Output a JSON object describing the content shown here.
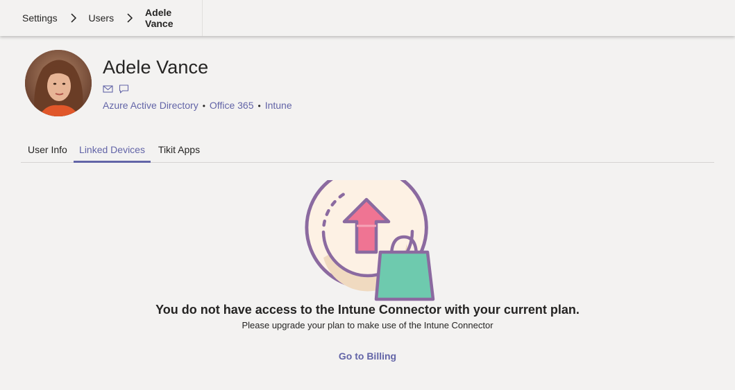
{
  "breadcrumb": {
    "items": [
      {
        "label": "Settings"
      },
      {
        "label": "Users"
      },
      {
        "label": "Adele Vance"
      }
    ]
  },
  "profile": {
    "name": "Adele Vance",
    "contact_icons": [
      "mail-icon",
      "chat-icon"
    ],
    "services": [
      "Azure Active Directory",
      "Office 365",
      "Intune"
    ],
    "separator": "•"
  },
  "tabs": [
    {
      "label": "User Info",
      "active": false
    },
    {
      "label": "Linked Devices",
      "active": true
    },
    {
      "label": "Tikit Apps",
      "active": false
    }
  ],
  "empty_state": {
    "illustration": "upgrade-shopping-bag-illustration",
    "heading": "You do not have access to the Intune Connector with your current plan.",
    "subtext": "Please upgrade your plan to make use of the Intune Connector",
    "action_label": "Go to Billing"
  },
  "colors": {
    "accent": "#6264a7",
    "background": "#f3f2f1",
    "illustration_purple": "#8b6aa0",
    "illustration_pink": "#ef7493",
    "illustration_green": "#6ecaae"
  }
}
